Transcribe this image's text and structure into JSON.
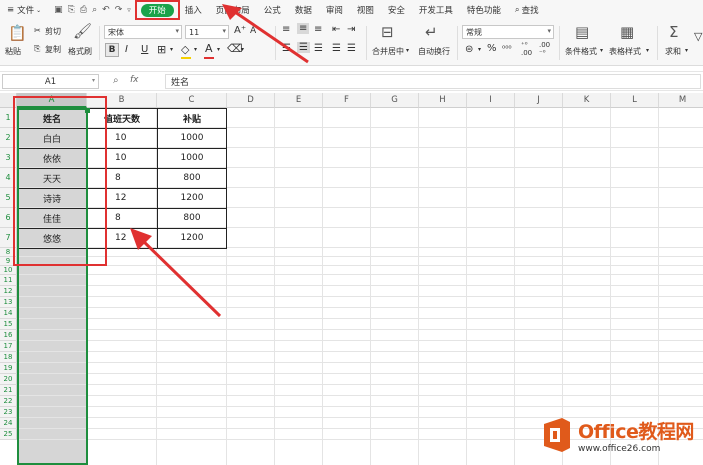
{
  "menubar": {
    "file": "文件",
    "tabs": [
      "开始",
      "插入",
      "页面布局",
      "公式",
      "数据",
      "审阅",
      "视图",
      "安全",
      "开发工具",
      "特色功能"
    ],
    "search": "查找"
  },
  "toolbar": {
    "paste": "粘贴",
    "cut": "剪切",
    "copy": "复制",
    "format_painter": "格式刷",
    "font_name": "宋体",
    "font_size": "11",
    "bold": "B",
    "italic": "I",
    "underline": "U",
    "merge_center": "合并居中",
    "wrap_text": "自动换行",
    "number_format": "常规",
    "conditional_format": "条件格式",
    "table_style": "表格样式",
    "sum": "求和",
    "font_color": "#e03131",
    "highlight_color": "#f5d000"
  },
  "formula_bar": {
    "cell_ref": "A1",
    "fx": "fx",
    "content": "姓名"
  },
  "sheet": {
    "columns": [
      "A",
      "B",
      "C",
      "D",
      "E",
      "F",
      "G",
      "H",
      "I",
      "J",
      "K",
      "L",
      "M"
    ],
    "rows": [
      "1",
      "2",
      "3",
      "4",
      "5",
      "6",
      "7",
      "8",
      "9",
      "10",
      "11",
      "12",
      "13",
      "14",
      "15",
      "16",
      "17",
      "18",
      "19",
      "20",
      "21",
      "22",
      "23",
      "24",
      "25"
    ],
    "table": {
      "headers": [
        "姓名",
        "值班天数",
        "补贴"
      ],
      "rows": [
        [
          "白白",
          "10",
          "1000"
        ],
        [
          "依依",
          "10",
          "1000"
        ],
        [
          "天天",
          "8",
          "800"
        ],
        [
          "诗诗",
          "12",
          "1200"
        ],
        [
          "佳佳",
          "8",
          "800"
        ],
        [
          "悠悠",
          "12",
          "1200"
        ]
      ]
    }
  },
  "watermark": {
    "title": "Office教程网",
    "url": "www.office26.com"
  },
  "colors": {
    "accent_green": "#1e8e3e",
    "annotation_red": "#e03131"
  }
}
